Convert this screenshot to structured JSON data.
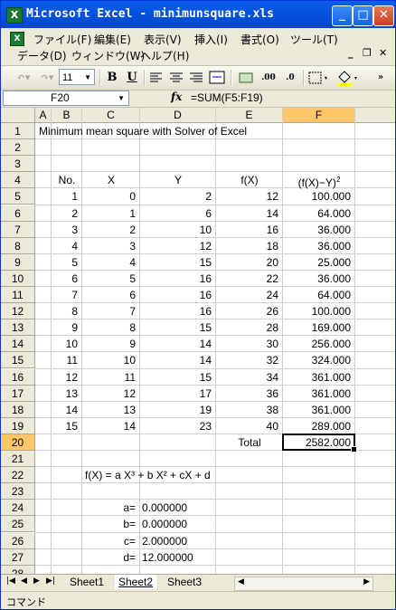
{
  "window": {
    "title": "Microsoft Excel - minimunsquare.xls",
    "app_icon": "X"
  },
  "title_buttons": {
    "minimize": "_",
    "maximize": "□",
    "close": "✕"
  },
  "menu": {
    "row1": [
      "ファイル(F)",
      "編集(E)",
      "表示(V)",
      "挿入(I)",
      "書式(O)",
      "ツール(T)"
    ],
    "row2": [
      "データ(D)",
      "ウィンドウ(W)",
      "ヘルプ(H)"
    ],
    "mdi": [
      "_",
      "❐",
      "✕"
    ]
  },
  "toolbar": {
    "font_size": "11",
    "bold": "B",
    "underline": "U",
    "fill_icon": "paint-bucket-icon"
  },
  "formula_bar": {
    "name_box": "F20",
    "fx": "fx",
    "formula": "=SUM(F5:F19)"
  },
  "columns": [
    "A",
    "B",
    "C",
    "D",
    "E",
    "F"
  ],
  "rows": [
    "1",
    "2",
    "3",
    "4",
    "5",
    "6",
    "7",
    "8",
    "9",
    "10",
    "11",
    "12",
    "13",
    "14",
    "15",
    "16",
    "17",
    "18",
    "19",
    "20",
    "21",
    "22",
    "23",
    "24",
    "25",
    "26",
    "27",
    "28"
  ],
  "active": {
    "column": "F",
    "row": "20"
  },
  "sheet": {
    "title": "Minimum mean square with Solver of Excel",
    "headers": {
      "no": "No.",
      "x": "X",
      "y": "Y",
      "fx": "f(X)",
      "sq": "(f(X)−Y)"
    },
    "data_rows": [
      [
        "1",
        "0",
        "2",
        "12",
        "100.000"
      ],
      [
        "2",
        "1",
        "6",
        "14",
        "64.000"
      ],
      [
        "3",
        "2",
        "10",
        "16",
        "36.000"
      ],
      [
        "4",
        "3",
        "12",
        "18",
        "36.000"
      ],
      [
        "5",
        "4",
        "15",
        "20",
        "25.000"
      ],
      [
        "6",
        "5",
        "16",
        "22",
        "36.000"
      ],
      [
        "7",
        "6",
        "16",
        "24",
        "64.000"
      ],
      [
        "8",
        "7",
        "16",
        "26",
        "100.000"
      ],
      [
        "9",
        "8",
        "15",
        "28",
        "169.000"
      ],
      [
        "10",
        "9",
        "14",
        "30",
        "256.000"
      ],
      [
        "11",
        "10",
        "14",
        "32",
        "324.000"
      ],
      [
        "12",
        "11",
        "15",
        "34",
        "361.000"
      ],
      [
        "13",
        "12",
        "17",
        "36",
        "361.000"
      ],
      [
        "14",
        "13",
        "19",
        "38",
        "361.000"
      ],
      [
        "15",
        "14",
        "23",
        "40",
        "289.000"
      ]
    ],
    "total_label": "Total",
    "total_value": "2582.000",
    "formula_text": "f(X) = a X³ + b X² + cX + d",
    "params": [
      [
        "a=",
        "0.000000"
      ],
      [
        "b=",
        "0.000000"
      ],
      [
        "c=",
        "2.000000"
      ],
      [
        "d=",
        "12.000000"
      ]
    ]
  },
  "tabs": [
    "Sheet1",
    "Sheet2",
    "Sheet3"
  ],
  "active_tab": "Sheet2",
  "status": "コマンド"
}
